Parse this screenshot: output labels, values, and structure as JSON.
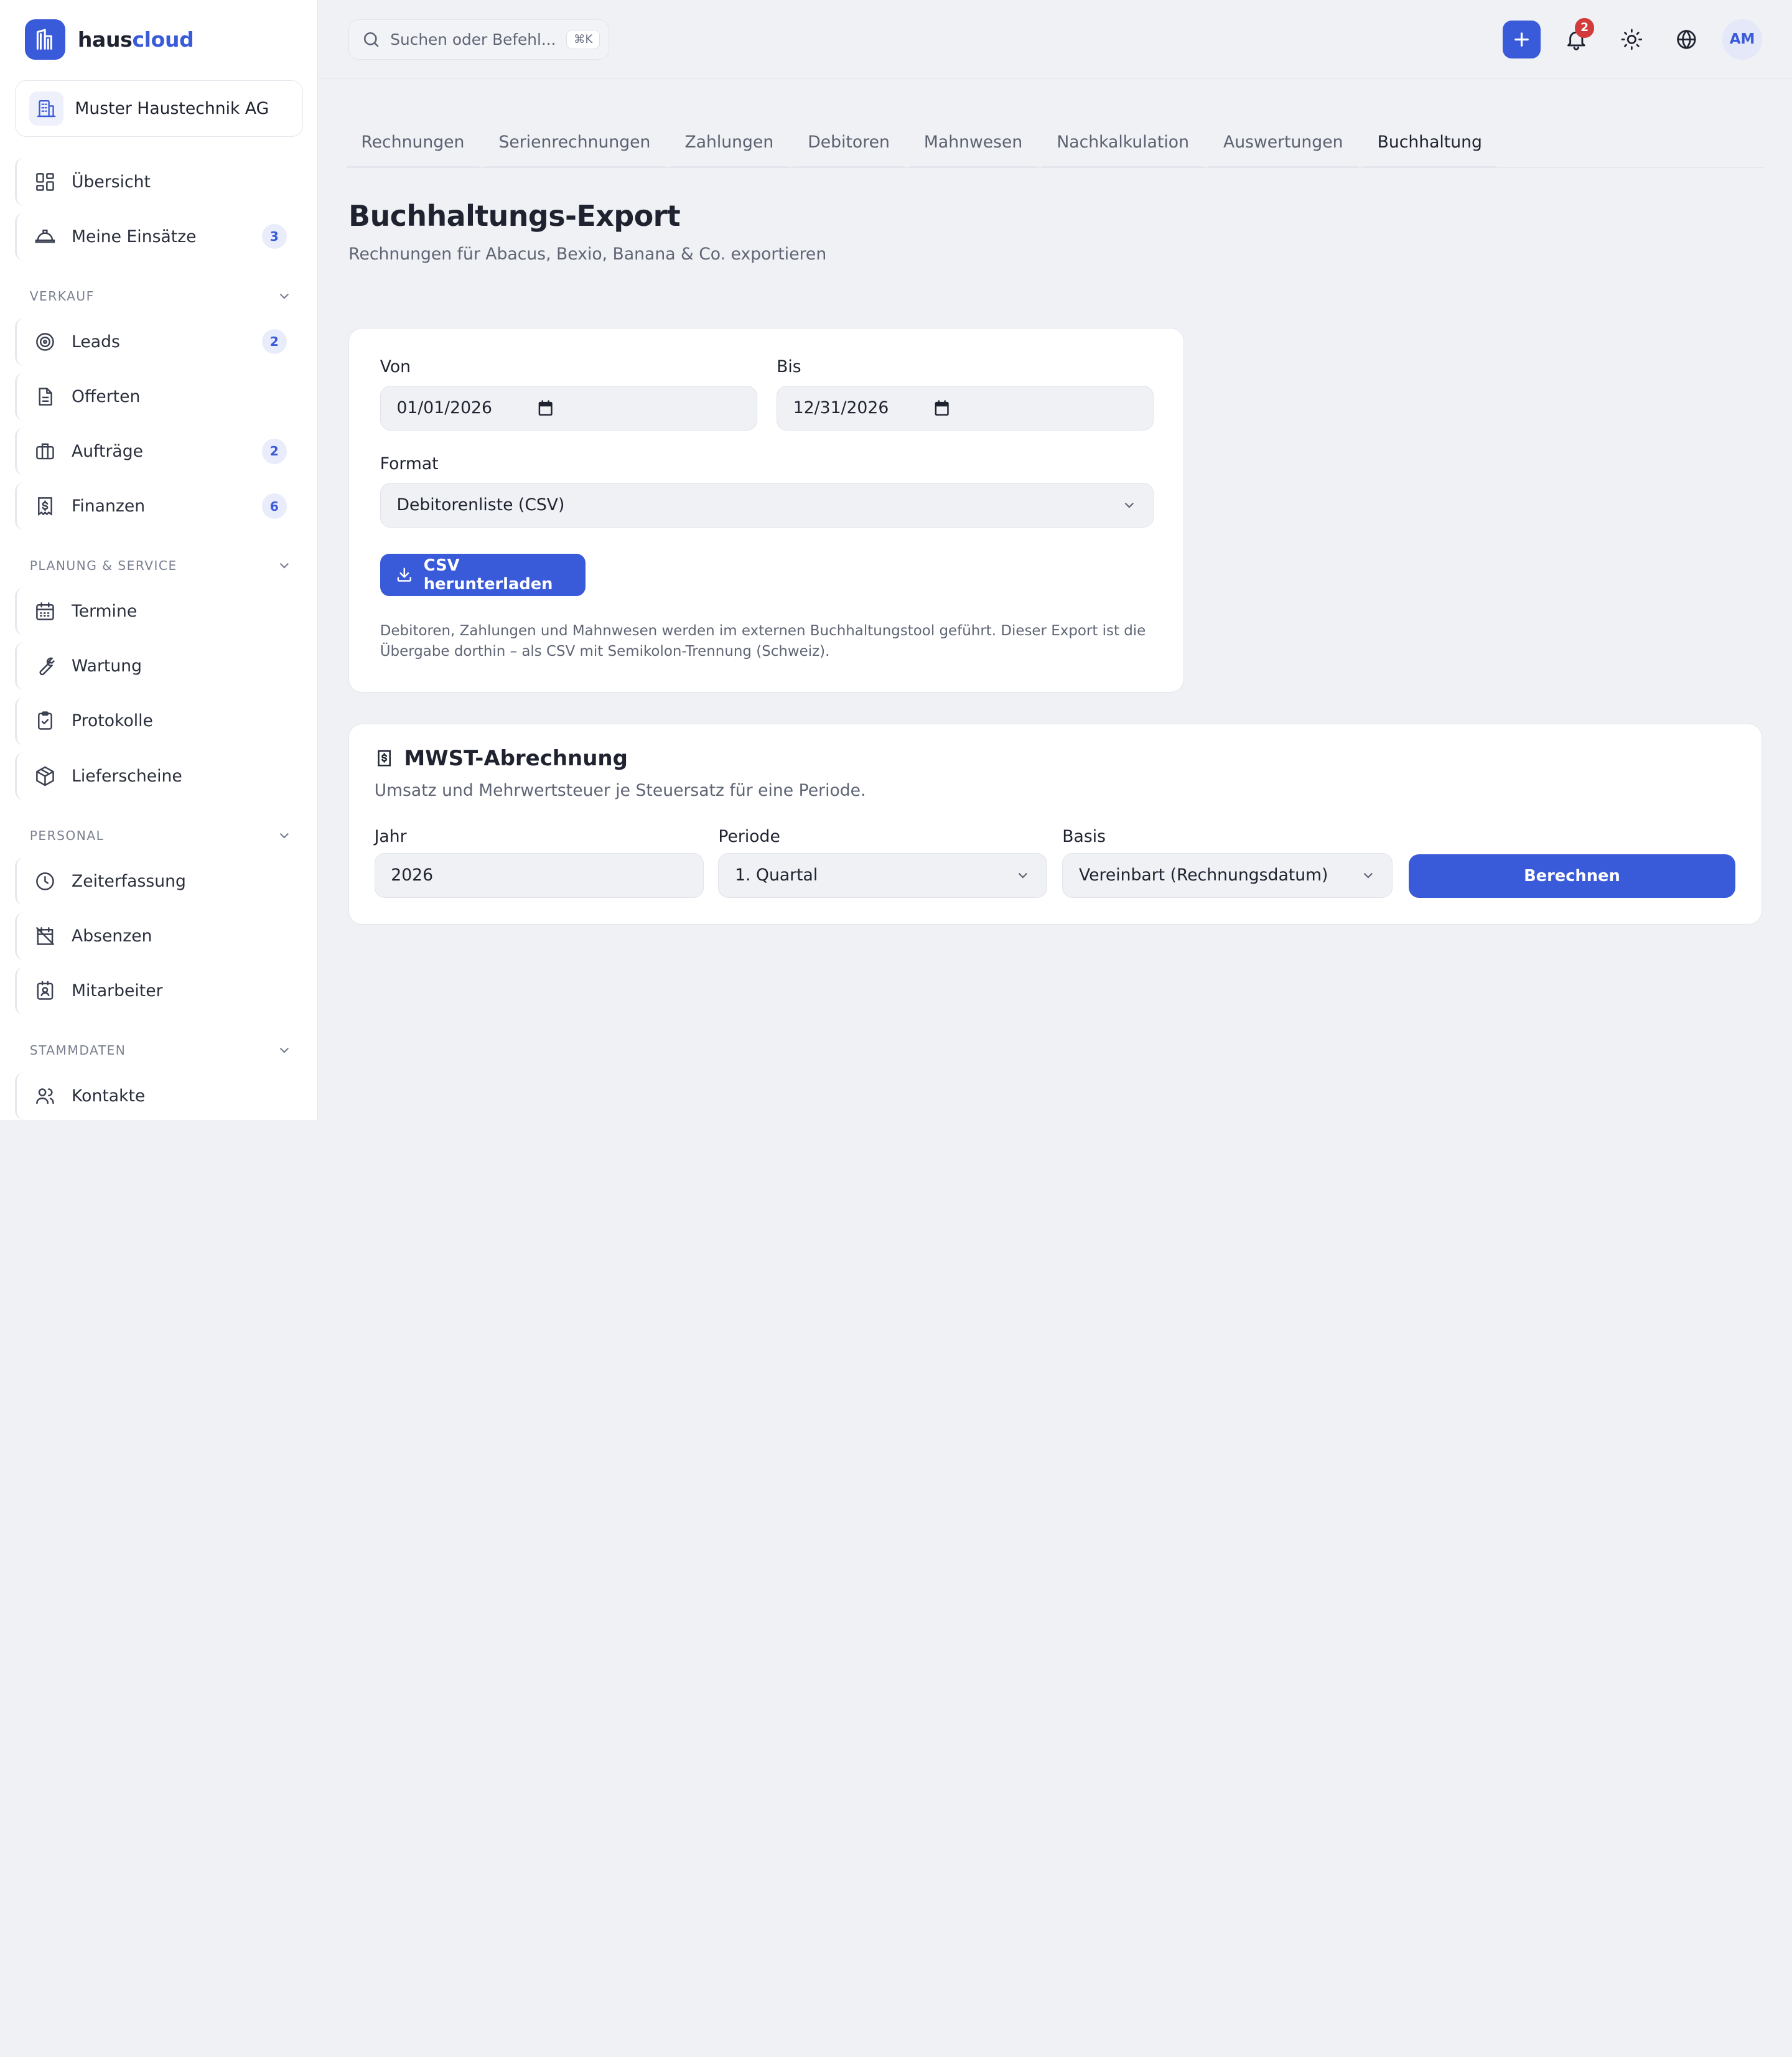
{
  "brand": {
    "part1": "haus",
    "part2": "cloud"
  },
  "company": {
    "name": "Muster Haustechnik AG"
  },
  "sidebar": {
    "top_items": [
      {
        "label": "Übersicht",
        "icon": "dashboard-icon"
      },
      {
        "label": "Meine Einsätze",
        "icon": "hardhat-icon",
        "badge": "3"
      }
    ],
    "sections": [
      {
        "title": "VERKAUF",
        "items": [
          {
            "label": "Leads",
            "icon": "target-icon",
            "badge": "2"
          },
          {
            "label": "Offerten",
            "icon": "document-icon"
          },
          {
            "label": "Aufträge",
            "icon": "briefcase-icon",
            "badge": "2"
          },
          {
            "label": "Finanzen",
            "icon": "receipt-icon",
            "badge": "6"
          }
        ]
      },
      {
        "title": "PLANUNG & SERVICE",
        "items": [
          {
            "label": "Termine",
            "icon": "calendar-icon"
          },
          {
            "label": "Wartung",
            "icon": "wrench-icon"
          },
          {
            "label": "Protokolle",
            "icon": "clipboard-check-icon"
          },
          {
            "label": "Lieferscheine",
            "icon": "package-icon"
          }
        ]
      },
      {
        "title": "PERSONAL",
        "items": [
          {
            "label": "Zeiterfassung",
            "icon": "clock-icon"
          },
          {
            "label": "Absenzen",
            "icon": "calendar-off-icon"
          },
          {
            "label": "Mitarbeiter",
            "icon": "id-badge-icon"
          }
        ]
      },
      {
        "title": "STAMMDATEN",
        "items": [
          {
            "label": "Kontakte",
            "icon": "users-icon"
          }
        ]
      }
    ]
  },
  "topbar": {
    "search_placeholder": "Suchen oder Befehl...",
    "shortcut": "⌘K",
    "notification_count": "2",
    "avatar_initials": "AM"
  },
  "tabs": [
    {
      "label": "Rechnungen",
      "active": false
    },
    {
      "label": "Serienrechnungen",
      "active": false
    },
    {
      "label": "Zahlungen",
      "active": false
    },
    {
      "label": "Debitoren",
      "active": false
    },
    {
      "label": "Mahnwesen",
      "active": false
    },
    {
      "label": "Nachkalkulation",
      "active": false
    },
    {
      "label": "Auswertungen",
      "active": false
    },
    {
      "label": "Buchhaltung",
      "active": true
    }
  ],
  "page": {
    "title": "Buchhaltungs-Export",
    "subtitle": "Rechnungen für Abacus, Bexio, Banana & Co. exportieren"
  },
  "export": {
    "from_label": "Von",
    "from_value": "01/01/2026",
    "to_label": "Bis",
    "to_value": "12/31/2026",
    "format_label": "Format",
    "format_value": "Debitorenliste (CSV)",
    "download_label": "CSV herunterladen",
    "note": "Debitoren, Zahlungen und Mahnwesen werden im externen Buchhaltungstool geführt. Dieser Export ist die Übergabe dorthin – als CSV mit Semikolon-Trennung (Schweiz)."
  },
  "mwst": {
    "title": "MWST-Abrechnung",
    "subtitle": "Umsatz und Mehrwertsteuer je Steuersatz für eine Periode.",
    "year_label": "Jahr",
    "year_value": "2026",
    "period_label": "Periode",
    "period_value": "1. Quartal",
    "basis_label": "Basis",
    "basis_value": "Vereinbart (Rechnungsdatum)",
    "calc_label": "Berechnen"
  },
  "colors": {
    "accent": "#3a5bd9",
    "badge_red": "#d23b3b",
    "background": "#eff1f5"
  }
}
